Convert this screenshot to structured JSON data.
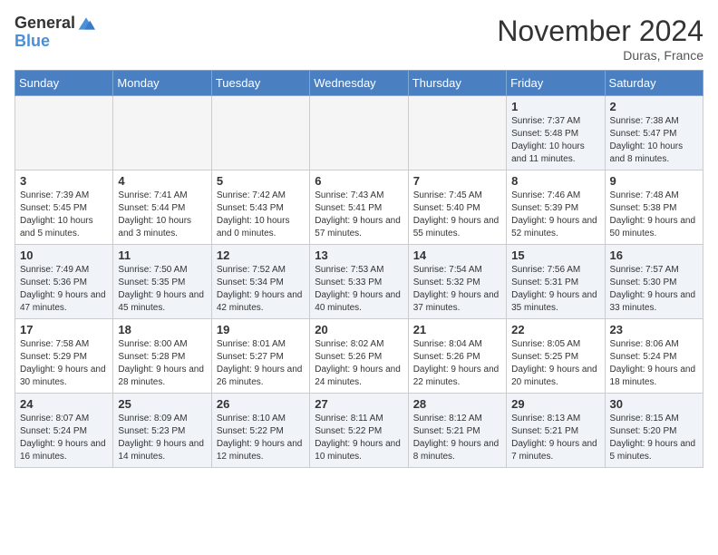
{
  "logo": {
    "general": "General",
    "blue": "Blue"
  },
  "title": "November 2024",
  "location": "Duras, France",
  "days_of_week": [
    "Sunday",
    "Monday",
    "Tuesday",
    "Wednesday",
    "Thursday",
    "Friday",
    "Saturday"
  ],
  "weeks": [
    [
      {
        "day": "",
        "info": ""
      },
      {
        "day": "",
        "info": ""
      },
      {
        "day": "",
        "info": ""
      },
      {
        "day": "",
        "info": ""
      },
      {
        "day": "",
        "info": ""
      },
      {
        "day": "1",
        "info": "Sunrise: 7:37 AM\nSunset: 5:48 PM\nDaylight: 10 hours and 11 minutes."
      },
      {
        "day": "2",
        "info": "Sunrise: 7:38 AM\nSunset: 5:47 PM\nDaylight: 10 hours and 8 minutes."
      }
    ],
    [
      {
        "day": "3",
        "info": "Sunrise: 7:39 AM\nSunset: 5:45 PM\nDaylight: 10 hours and 5 minutes."
      },
      {
        "day": "4",
        "info": "Sunrise: 7:41 AM\nSunset: 5:44 PM\nDaylight: 10 hours and 3 minutes."
      },
      {
        "day": "5",
        "info": "Sunrise: 7:42 AM\nSunset: 5:43 PM\nDaylight: 10 hours and 0 minutes."
      },
      {
        "day": "6",
        "info": "Sunrise: 7:43 AM\nSunset: 5:41 PM\nDaylight: 9 hours and 57 minutes."
      },
      {
        "day": "7",
        "info": "Sunrise: 7:45 AM\nSunset: 5:40 PM\nDaylight: 9 hours and 55 minutes."
      },
      {
        "day": "8",
        "info": "Sunrise: 7:46 AM\nSunset: 5:39 PM\nDaylight: 9 hours and 52 minutes."
      },
      {
        "day": "9",
        "info": "Sunrise: 7:48 AM\nSunset: 5:38 PM\nDaylight: 9 hours and 50 minutes."
      }
    ],
    [
      {
        "day": "10",
        "info": "Sunrise: 7:49 AM\nSunset: 5:36 PM\nDaylight: 9 hours and 47 minutes."
      },
      {
        "day": "11",
        "info": "Sunrise: 7:50 AM\nSunset: 5:35 PM\nDaylight: 9 hours and 45 minutes."
      },
      {
        "day": "12",
        "info": "Sunrise: 7:52 AM\nSunset: 5:34 PM\nDaylight: 9 hours and 42 minutes."
      },
      {
        "day": "13",
        "info": "Sunrise: 7:53 AM\nSunset: 5:33 PM\nDaylight: 9 hours and 40 minutes."
      },
      {
        "day": "14",
        "info": "Sunrise: 7:54 AM\nSunset: 5:32 PM\nDaylight: 9 hours and 37 minutes."
      },
      {
        "day": "15",
        "info": "Sunrise: 7:56 AM\nSunset: 5:31 PM\nDaylight: 9 hours and 35 minutes."
      },
      {
        "day": "16",
        "info": "Sunrise: 7:57 AM\nSunset: 5:30 PM\nDaylight: 9 hours and 33 minutes."
      }
    ],
    [
      {
        "day": "17",
        "info": "Sunrise: 7:58 AM\nSunset: 5:29 PM\nDaylight: 9 hours and 30 minutes."
      },
      {
        "day": "18",
        "info": "Sunrise: 8:00 AM\nSunset: 5:28 PM\nDaylight: 9 hours and 28 minutes."
      },
      {
        "day": "19",
        "info": "Sunrise: 8:01 AM\nSunset: 5:27 PM\nDaylight: 9 hours and 26 minutes."
      },
      {
        "day": "20",
        "info": "Sunrise: 8:02 AM\nSunset: 5:26 PM\nDaylight: 9 hours and 24 minutes."
      },
      {
        "day": "21",
        "info": "Sunrise: 8:04 AM\nSunset: 5:26 PM\nDaylight: 9 hours and 22 minutes."
      },
      {
        "day": "22",
        "info": "Sunrise: 8:05 AM\nSunset: 5:25 PM\nDaylight: 9 hours and 20 minutes."
      },
      {
        "day": "23",
        "info": "Sunrise: 8:06 AM\nSunset: 5:24 PM\nDaylight: 9 hours and 18 minutes."
      }
    ],
    [
      {
        "day": "24",
        "info": "Sunrise: 8:07 AM\nSunset: 5:24 PM\nDaylight: 9 hours and 16 minutes."
      },
      {
        "day": "25",
        "info": "Sunrise: 8:09 AM\nSunset: 5:23 PM\nDaylight: 9 hours and 14 minutes."
      },
      {
        "day": "26",
        "info": "Sunrise: 8:10 AM\nSunset: 5:22 PM\nDaylight: 9 hours and 12 minutes."
      },
      {
        "day": "27",
        "info": "Sunrise: 8:11 AM\nSunset: 5:22 PM\nDaylight: 9 hours and 10 minutes."
      },
      {
        "day": "28",
        "info": "Sunrise: 8:12 AM\nSunset: 5:21 PM\nDaylight: 9 hours and 8 minutes."
      },
      {
        "day": "29",
        "info": "Sunrise: 8:13 AM\nSunset: 5:21 PM\nDaylight: 9 hours and 7 minutes."
      },
      {
        "day": "30",
        "info": "Sunrise: 8:15 AM\nSunset: 5:20 PM\nDaylight: 9 hours and 5 minutes."
      }
    ]
  ]
}
